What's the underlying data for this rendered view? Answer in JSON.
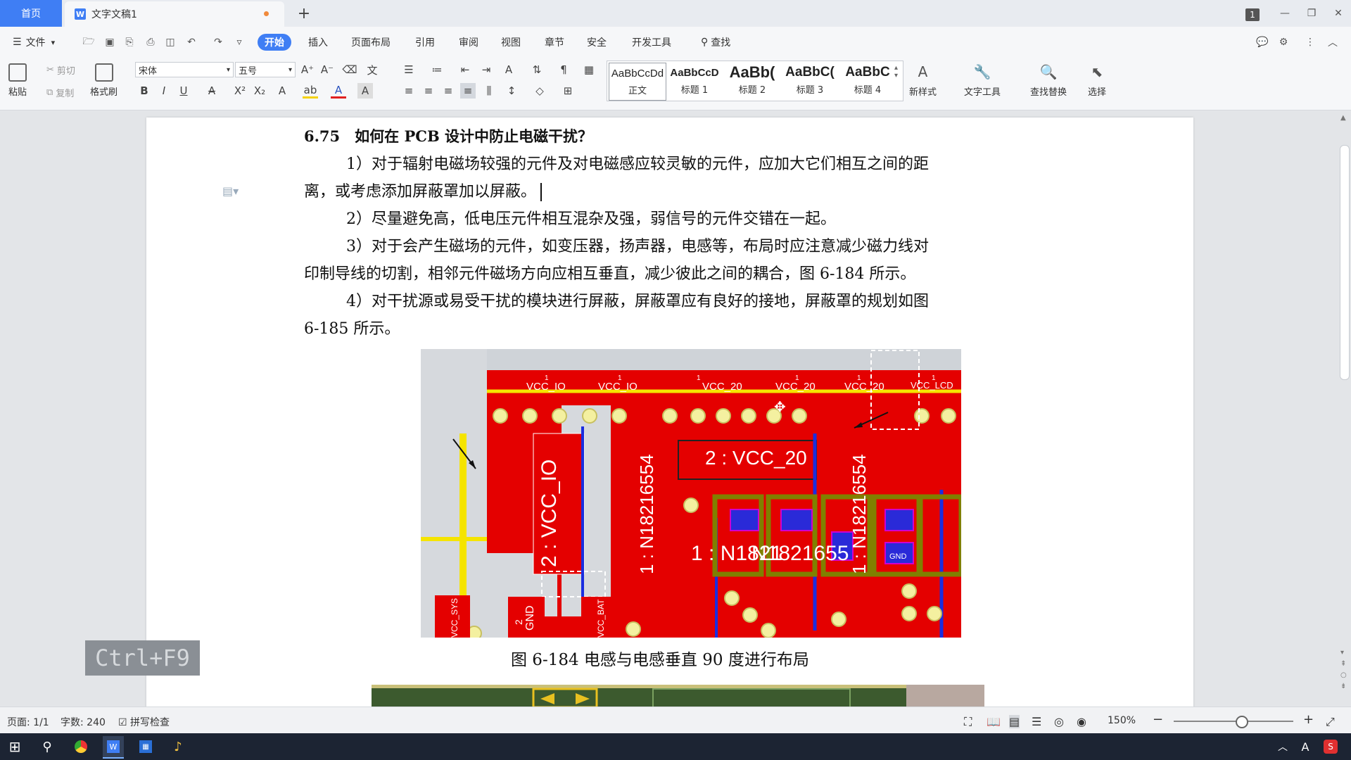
{
  "tabs": {
    "home": "首页",
    "doc": "文字文稿1",
    "add": "+"
  },
  "window": {
    "badge": "1"
  },
  "menu": {
    "file": "文件",
    "items": [
      "开始",
      "插入",
      "页面布局",
      "引用",
      "审阅",
      "视图",
      "章节",
      "安全",
      "开发工具"
    ],
    "search": "查找"
  },
  "ribbon": {
    "paste": "粘贴",
    "cut": "剪切",
    "copy": "复制",
    "format_painter": "格式刷",
    "font_name": "宋体",
    "font_size": "五号",
    "styles": [
      {
        "preview": "AaBbCcDd",
        "name": "正文"
      },
      {
        "preview": "AaBbCcD",
        "name": "标题 1"
      },
      {
        "preview": "AaBb(",
        "name": "标题 2"
      },
      {
        "preview": "AaBbC(",
        "name": "标题 3"
      },
      {
        "preview": "AaBbC",
        "name": "标题 4"
      }
    ],
    "new_style": "新样式",
    "text_tools": "文字工具",
    "find_replace": "查找替换",
    "select": "选择"
  },
  "document": {
    "heading": "6.75　如何在 PCB 设计中防止电磁干扰？",
    "lines": [
      "1）对于辐射电磁场较强的元件及对电磁感应较灵敏的元件，应加大它们相互之间的距",
      "离，或考虑添加屏蔽罩加以屏蔽。",
      "2）尽量避免高，低电压元件相互混杂及强，弱信号的元件交错在一起。",
      "3）对于会产生磁场的元件，如变压器，扬声器，电感等，布局时应注意减少磁力线对",
      "印制导线的切割，相邻元件磁场方向应相互垂直，减少彼此之间的耦合，图 6-184 所示。",
      "4）对干扰源或易受干扰的模块进行屏蔽，屏蔽罩应有良好的接地，屏蔽罩的规划如图",
      "6-185 所示。"
    ],
    "caption": "图 6-184 电感与电感垂直 90 度进行布局",
    "pcb_labels": {
      "vcc_io": "VCC_IO",
      "vcc_20": "VCC_20",
      "vcc_lcd": "VCC_LCD",
      "net_vcc20": "2 : VCC_20",
      "net_vccio": "2 : VCC_IO",
      "net_n1": "1 : N18216554",
      "net_n2": "1 : N18216554",
      "net_n3": "1 : N1821",
      "net_n4": "N1821655",
      "gnd": "GND",
      "vcc_sys": "VCC_SYS",
      "vcc_bat": "VCC_BAT",
      "pin1": "1",
      "pin2": "2"
    }
  },
  "overlay": {
    "shortcut": "Ctrl+F9"
  },
  "status": {
    "page": "页面: 1/1",
    "words": "字数: 240",
    "spell": "拼写检查",
    "zoom": "150%"
  }
}
